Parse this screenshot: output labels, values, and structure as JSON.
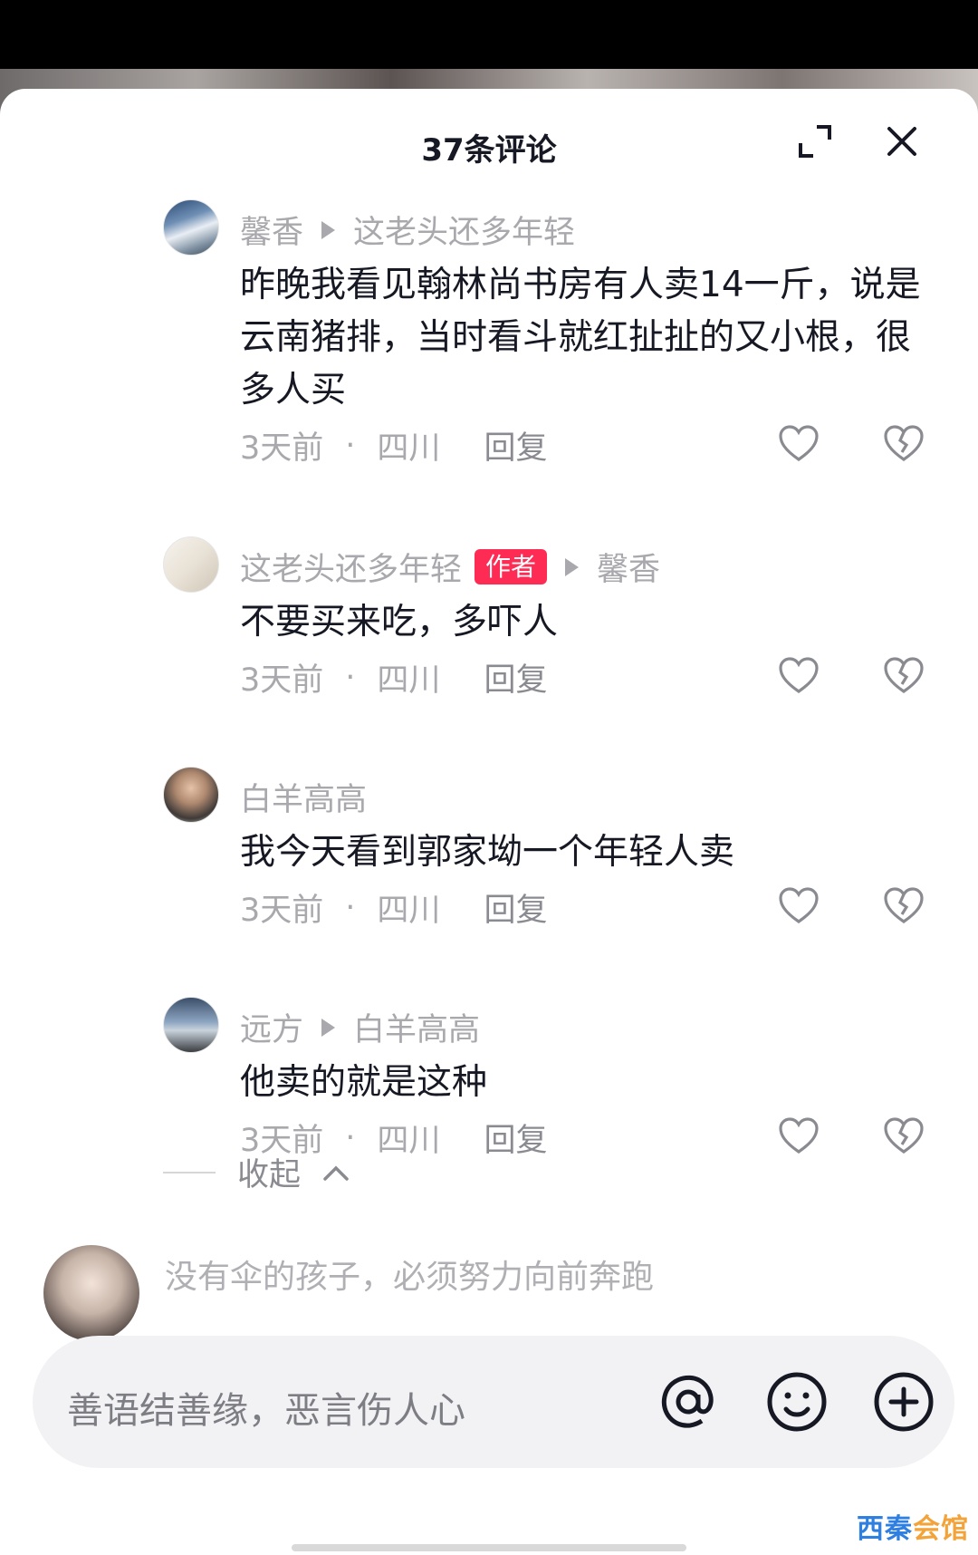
{
  "header": {
    "title": "37条评论"
  },
  "comments": [
    {
      "user": "馨香",
      "reply_to": "这老头还多年轻",
      "text": "昨晚我看见翰林尚书房有人卖14一斤，说是云南猪排，当时看斗就红扯扯的又小根，很多人买",
      "time": "3天前",
      "location": "四川",
      "reply_label": "回复"
    },
    {
      "user": "这老头还多年轻",
      "badge": "作者",
      "reply_to": "馨香",
      "text": "不要买来吃，多吓人",
      "time": "3天前",
      "location": "四川",
      "reply_label": "回复"
    },
    {
      "user": "白羊高高",
      "text": "我今天看到郭家坳一个年轻人卖",
      "time": "3天前",
      "location": "四川",
      "reply_label": "回复"
    },
    {
      "user": "远方",
      "reply_to": "白羊高高",
      "text": "他卖的就是这种",
      "time": "3天前",
      "location": "四川",
      "reply_label": "回复"
    }
  ],
  "separator_dot": "·",
  "collapse_label": "收起",
  "next_comment_preview": "没有伞的孩子，必须努力向前奔跑",
  "composer": {
    "placeholder": "善语结善缘，恶言伤人心"
  },
  "watermark": {
    "part1": "西秦",
    "part2": "会馆"
  },
  "icons": {
    "expand": "expand-icon",
    "close": "close-icon",
    "like": "heart-icon",
    "dislike": "broken-heart-icon",
    "at": "at-icon",
    "emoji": "emoji-icon",
    "add": "plus-circle-icon",
    "collapse": "chevron-up-icon"
  },
  "colors": {
    "author_badge": "#fe2c55",
    "text_primary": "#161823",
    "text_secondary": "#a8a8ad"
  }
}
